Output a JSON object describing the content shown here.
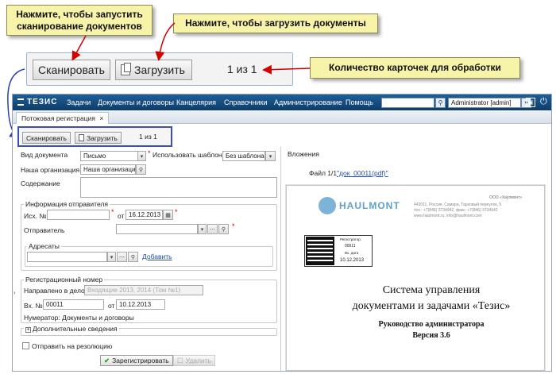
{
  "callouts": {
    "scan": "Нажмите, чтобы запустить сканирование документов",
    "upload": "Нажмите, чтобы загрузить документы",
    "count": "Количество карточек для обработки"
  },
  "zoom": {
    "scan_label": "Сканировать",
    "upload_label": "Загрузить",
    "counter": "1 из 1"
  },
  "app": {
    "logo": "ТЕЗИС",
    "menu": [
      "Задачи",
      "Документы и договоры",
      "Канцелярия",
      "Справочники",
      "Администрирование",
      "Помощь"
    ],
    "user": "Administrator [admin]",
    "tab": "Потоковая регистрация",
    "tab_close": "×",
    "toolbar": {
      "scan_label": "Сканировать",
      "upload_label": "Загрузить",
      "counter": "1 из 1"
    },
    "form": {
      "doc_type_label": "Вид документа",
      "doc_type_value": "Письмо",
      "use_template_label": "Использовать шаблон",
      "template_value": "Без шаблона",
      "org_label": "Наша организация",
      "org_value": "Наша организация",
      "content_label": "Содержание",
      "sender_group": "Информация отправителя",
      "out_no_label": "Исх. №",
      "out_date_prefix": "от",
      "out_date": "16.12.2013",
      "sender_label": "Отправитель",
      "addressees_group": "Адресаты",
      "add_link": "Добавить",
      "reg_group": "Регистрационный номер",
      "case_label": "Направлено в дело",
      "case_value": "Входящие 2013, 2014 (Том №1)",
      "in_no_label": "Вх. №",
      "in_no_value": "00011",
      "in_date_prefix": "от",
      "in_date": "10.12.2013",
      "numerator": "Нумератор: Документы и договоры",
      "extra_info": "Дополнительные сведения",
      "send_resolution": "Отправить на резолюцию",
      "register_button": "Зарегистрировать",
      "delete_button": "Удалить"
    },
    "attachments": {
      "title": "Вложения",
      "file_prefix": "Файл 1/1",
      "file_link": "\"док_00011(pdf)\""
    },
    "document": {
      "brand": "HAULMONT",
      "company_lines": [
        "ООО «Хаулмонт»",
        "443011, Россия, Самара, Тарховый переулок, 5",
        "тел.: +7(846) 3734942, факс: +7(846) 3734942",
        "www.haulmont.ru, info@haulmont.com"
      ],
      "stamp_lines": [
        "Регистратор",
        "00011",
        "Вх. дата",
        "10.12.2013"
      ],
      "title_line1": "Система управления",
      "title_line2": "документами и задачами «Тезис»",
      "subtitle": "Руководство администратора",
      "version": "Версия 3.6"
    }
  },
  "colors": {
    "callout_bg": "#f7f4a9",
    "topbar": "#1d5f98",
    "arrow": "#d40000",
    "link": "#1f4fb0"
  }
}
